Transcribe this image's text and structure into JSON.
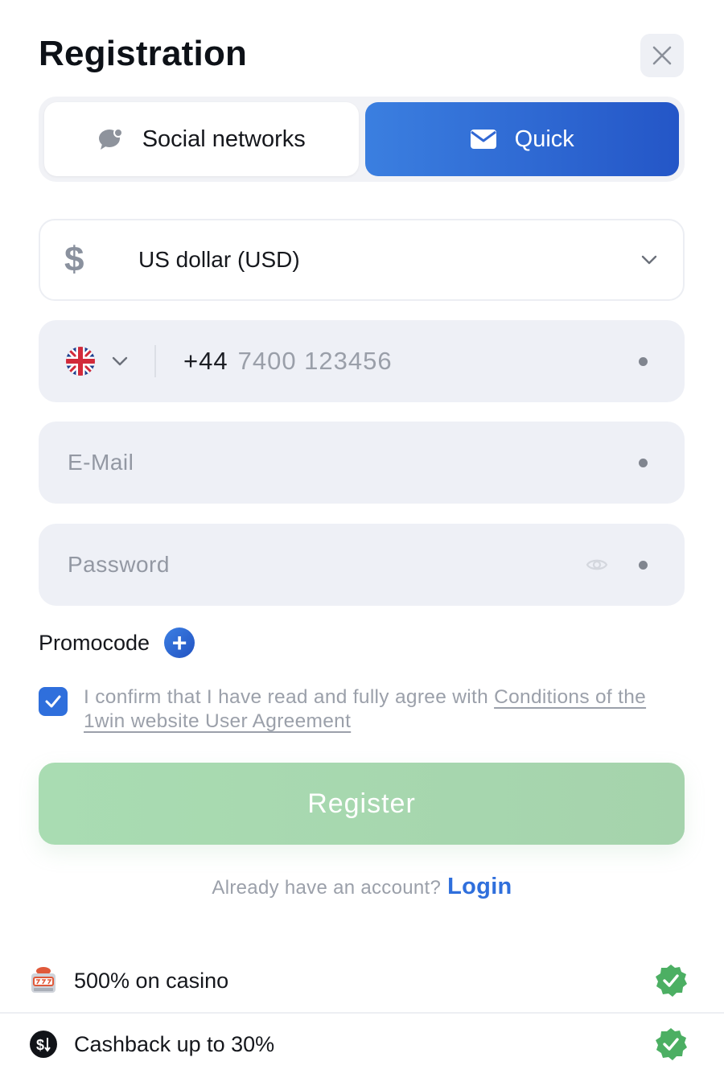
{
  "header": {
    "title": "Registration",
    "close_icon": "close-icon"
  },
  "tabs": [
    {
      "label": "Social networks",
      "icon": "chat-bubble-icon",
      "active": false
    },
    {
      "label": "Quick",
      "icon": "envelope-icon",
      "active": true
    }
  ],
  "currency": {
    "symbol": "$",
    "label": "US dollar (USD)",
    "icon": "chevron-down-icon"
  },
  "phone": {
    "country_flag": "uk-flag-icon",
    "code": "+44",
    "placeholder": "7400 123456",
    "required": true
  },
  "email": {
    "placeholder": "E-Mail",
    "required": true
  },
  "password": {
    "placeholder": "Password",
    "required": true,
    "icon": "eye-icon"
  },
  "promo": {
    "label": "Promocode",
    "button": "+"
  },
  "agreement": {
    "checked": true,
    "text": "I confirm that I have read and fully agree with ",
    "link_text": "Conditions of the 1win website User Agreement"
  },
  "register_button": "Register",
  "login": {
    "prompt": "Already have an account?",
    "link": "Login"
  },
  "bonuses": [
    {
      "icon": "slot-machine-icon",
      "text": "500% on casino"
    },
    {
      "icon": "cashback-icon",
      "text": "Cashback up to 30%"
    }
  ],
  "colors": {
    "accent": "#2f6fdc",
    "register_bg": "#a9dcb2",
    "badge": "#4caf63",
    "field_bg": "#eef0f6"
  }
}
